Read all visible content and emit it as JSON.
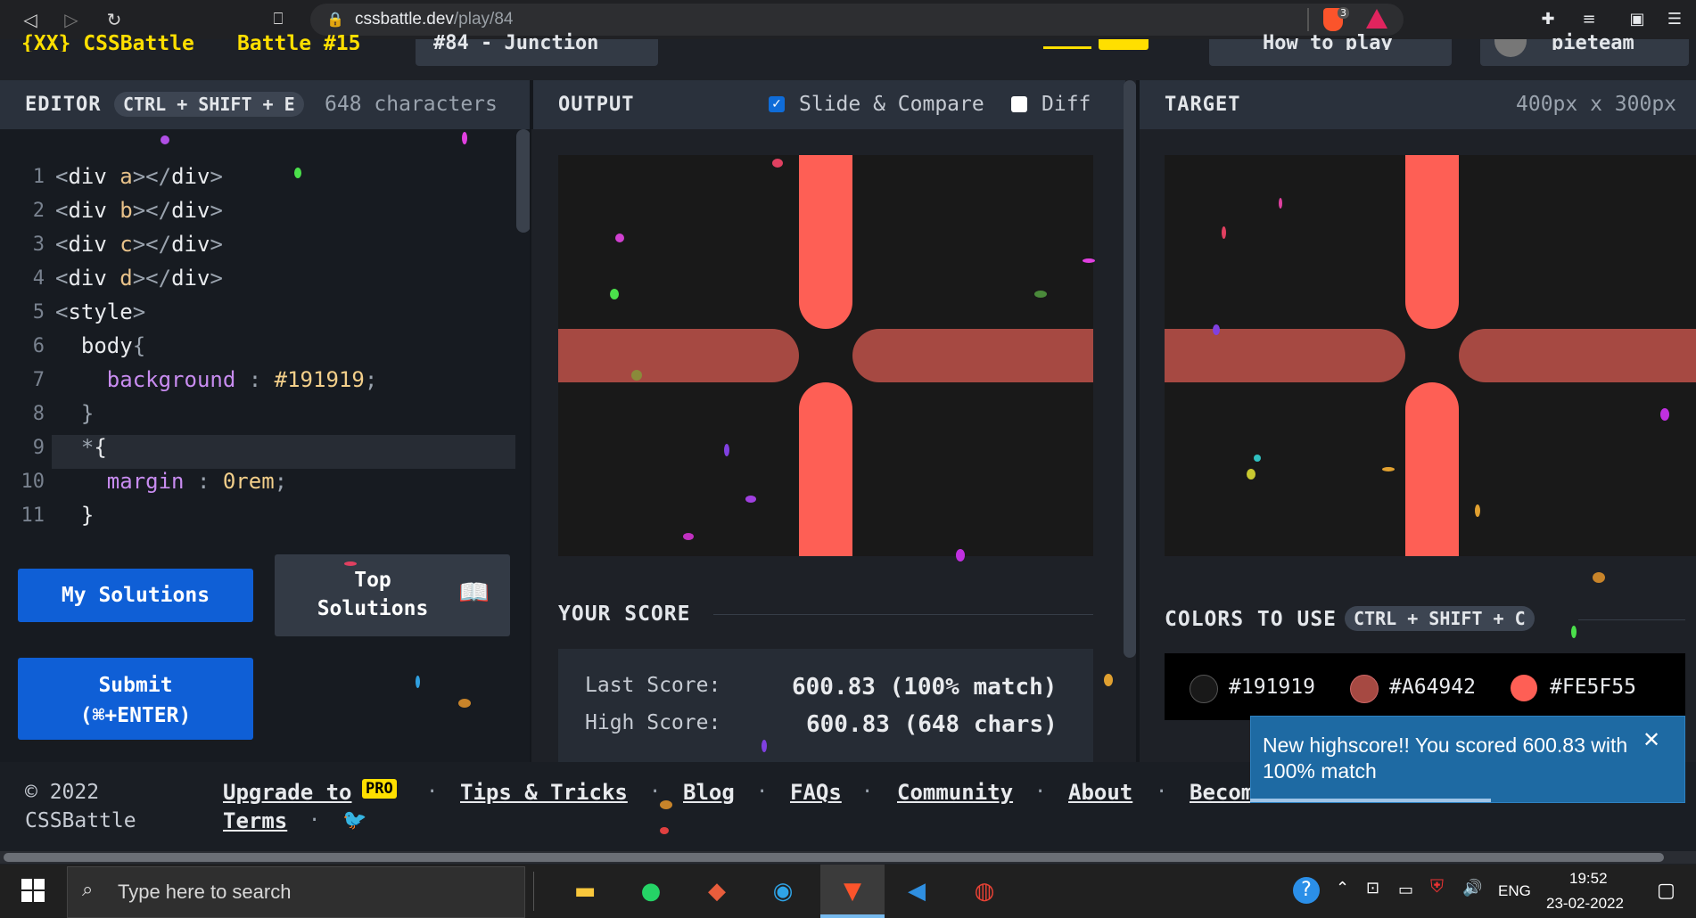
{
  "browser": {
    "url_host": "cssbattle.dev",
    "url_path": "/play/84",
    "shield_badge": "3"
  },
  "header": {
    "logo": "{XX} CSSBattle",
    "battle": "Battle #15",
    "target_name": "#84 - Junction",
    "howto": "How to play",
    "user": "pieteam"
  },
  "editor": {
    "title": "EDITOR",
    "shortcut": "CTRL + SHIFT + E",
    "chars": "648 characters",
    "lines": [
      {
        "n": "1",
        "text": "<div a></div>"
      },
      {
        "n": "2",
        "text": "<div b></div>"
      },
      {
        "n": "3",
        "text": "<div c></div>"
      },
      {
        "n": "4",
        "text": "<div d></div>"
      },
      {
        "n": "5",
        "text": "<style>"
      },
      {
        "n": "6",
        "text": "  body{"
      },
      {
        "n": "7",
        "text": "    background : #191919;"
      },
      {
        "n": "8",
        "text": "  }"
      },
      {
        "n": "9",
        "text": "  *{"
      },
      {
        "n": "10",
        "text": "    margin : 0rem;"
      },
      {
        "n": "11",
        "text": "  }"
      }
    ],
    "my_solutions": "My Solutions",
    "top_solutions_1": "Top",
    "top_solutions_2": "Solutions",
    "submit": "Submit",
    "submit_shortcut": "(⌘+ENTER)"
  },
  "output": {
    "title": "OUTPUT",
    "slide_compare": "Slide & Compare",
    "slide_compare_checked": true,
    "diff": "Diff",
    "diff_checked": false,
    "your_score": "YOUR SCORE",
    "last_score_label": "Last Score:",
    "last_score_value": "600.83 (100% match)",
    "high_score_label": "High Score:",
    "high_score_value": "600.83 (648 chars)"
  },
  "target": {
    "title": "TARGET",
    "size": "400px x 300px",
    "colors_title": "COLORS TO USE",
    "colors_shortcut": "CTRL + SHIFT + C",
    "colors": [
      {
        "hex": "#191919"
      },
      {
        "hex": "#A64942"
      },
      {
        "hex": "#FE5F55"
      }
    ]
  },
  "toast": {
    "message": "New highscore!! You scored 600.83 with 100% match",
    "close": "✕"
  },
  "footer": {
    "copyright": "© 2022",
    "brand": "CSSBattle",
    "links": [
      "Upgrade to",
      "Tips & Tricks",
      "Blog",
      "FAQs",
      "Community",
      "About",
      "Becom"
    ],
    "pro_badge": "PRO",
    "terms": "Terms"
  },
  "taskbar": {
    "search_placeholder": "Type here to search",
    "lang": "ENG",
    "time": "19:52",
    "date": "23-02-2022"
  }
}
